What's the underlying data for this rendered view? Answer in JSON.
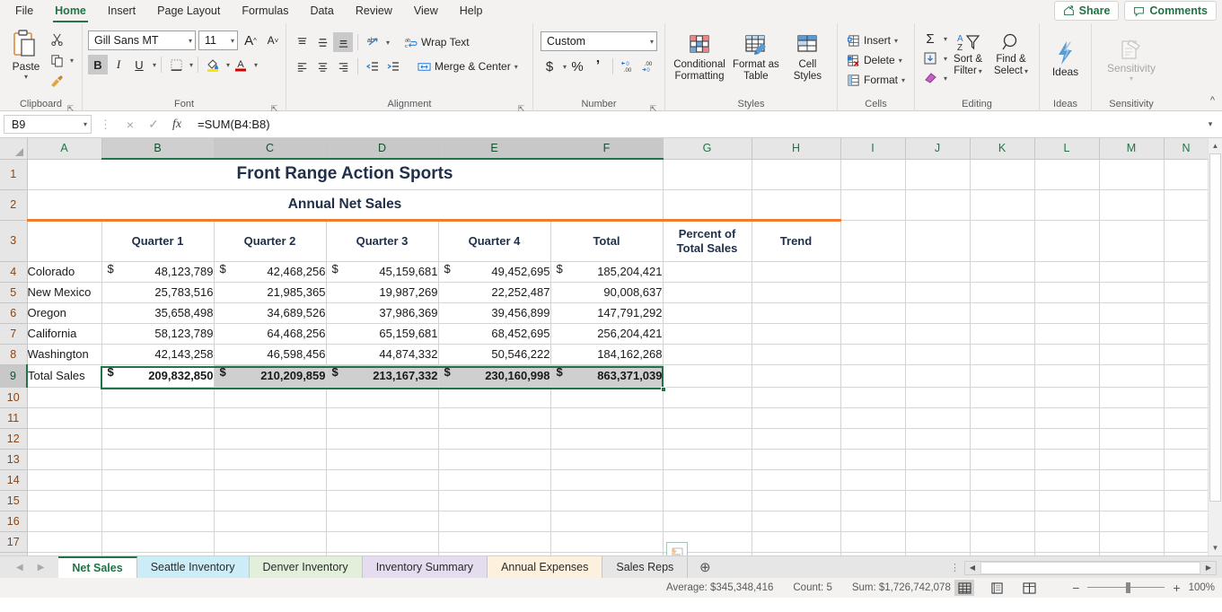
{
  "ribbon": {
    "tabs": [
      {
        "label": "File"
      },
      {
        "label": "Home"
      },
      {
        "label": "Insert"
      },
      {
        "label": "Page Layout"
      },
      {
        "label": "Formulas"
      },
      {
        "label": "Data"
      },
      {
        "label": "Review"
      },
      {
        "label": "View"
      },
      {
        "label": "Help"
      }
    ],
    "share_label": "Share",
    "comments_label": "Comments",
    "groups": {
      "clipboard": {
        "label": "Clipboard",
        "paste_label": "Paste",
        "cut_name": "cut-icon",
        "copy_name": "copy-icon",
        "format_painter_name": "format-painter-icon"
      },
      "font": {
        "label": "Font",
        "font_name": "Gill Sans MT",
        "font_size": "11",
        "grow_label": "A",
        "shrink_label": "A",
        "bold_label": "B",
        "italic_label": "I",
        "underline_label": "U"
      },
      "alignment": {
        "label": "Alignment",
        "wrap_text_label": "Wrap Text",
        "merge_center_label": "Merge & Center"
      },
      "number": {
        "label": "Number",
        "format_value": "Custom",
        "currency_label": "$",
        "percent_label": "%",
        "comma_label": " , ",
        "decrease_decimal_label": ".00",
        "increase_decimal_label": ".00"
      },
      "styles": {
        "label": "Styles",
        "conditional_formatting_label": "Conditional\nFormatting",
        "conditional_formatting_l1": "Conditional",
        "conditional_formatting_l2": "Formatting",
        "format_as_table_l1": "Format as",
        "format_as_table_l2": "Table",
        "cell_styles_l1": "Cell",
        "cell_styles_l2": "Styles"
      },
      "cells": {
        "label": "Cells",
        "insert_label": "Insert",
        "delete_label": "Delete",
        "format_label": "Format"
      },
      "editing": {
        "label": "Editing",
        "autosum_label": "Σ",
        "fill_label": "↓",
        "clear_label": "◇",
        "sort_filter_l1": "Sort &",
        "sort_filter_l2": "Filter",
        "find_select_l1": "Find &",
        "find_select_l2": "Select"
      },
      "ideas": {
        "label": "Ideas",
        "button_label": "Ideas"
      },
      "sensitivity": {
        "label": "Sensitivity",
        "button_label": "Sensitivity"
      }
    }
  },
  "formula_bar": {
    "name_box": "B9",
    "formula": "=SUM(B4:B8)",
    "cancel_icon": "×",
    "enter_icon": "✓",
    "function_icon": "fx"
  },
  "grid": {
    "column_headers": [
      "A",
      "B",
      "C",
      "D",
      "E",
      "F",
      "G",
      "H",
      "I",
      "J",
      "K",
      "L",
      "M",
      "N"
    ],
    "row_headers": [
      "1",
      "2",
      "3",
      "4",
      "5",
      "6",
      "7",
      "8",
      "9",
      "10",
      "11",
      "12",
      "13",
      "14",
      "15",
      "16",
      "17"
    ],
    "title": "Front Range Action Sports",
    "subtitle": "Annual Net Sales",
    "headers": {
      "blank": "",
      "q1": "Quarter 1",
      "q2": "Quarter 2",
      "q3": "Quarter 3",
      "q4": "Quarter 4",
      "total": "Total",
      "percent_l1": "Percent of",
      "percent_l2": "Total Sales",
      "trend": "Trend"
    },
    "currency_symbol": "$",
    "rows": [
      {
        "state": "Colorado",
        "q1": "48,123,789",
        "q2": "42,468,256",
        "q3": "45,159,681",
        "q4": "49,452,695",
        "total": "185,204,421"
      },
      {
        "state": "New Mexico",
        "q1": "25,783,516",
        "q2": "21,985,365",
        "q3": "19,987,269",
        "q4": "22,252,487",
        "total": "90,008,637"
      },
      {
        "state": "Oregon",
        "q1": "35,658,498",
        "q2": "34,689,526",
        "q3": "37,986,369",
        "q4": "39,456,899",
        "total": "147,791,292"
      },
      {
        "state": "California",
        "q1": "58,123,789",
        "q2": "64,468,256",
        "q3": "65,159,681",
        "q4": "68,452,695",
        "total": "256,204,421"
      },
      {
        "state": "Washington",
        "q1": "42,143,258",
        "q2": "46,598,456",
        "q3": "44,874,332",
        "q4": "50,546,222",
        "total": "184,162,268"
      }
    ],
    "total_row": {
      "label": "Total Sales",
      "q1": "209,832,850",
      "q2": "210,209,859",
      "q3": "213,167,332",
      "q4": "230,160,998",
      "total": "863,371,039"
    },
    "accent_color": "#ed7d31",
    "selection_color": "#217346",
    "quick_analysis_name": "quick-analysis-button"
  },
  "sheet_tabs": {
    "items": [
      {
        "label": "Net Sales",
        "color": "#ffffff",
        "active": true
      },
      {
        "label": "Seattle Inventory",
        "color": "#ccecf7",
        "active": false
      },
      {
        "label": "Denver Inventory",
        "color": "#e2efda",
        "active": false
      },
      {
        "label": "Inventory Summary",
        "color": "#e6dcf0",
        "active": false
      },
      {
        "label": "Annual Expenses",
        "color": "#fdf0dd",
        "active": false
      },
      {
        "label": "Sales Reps",
        "color": "#e6e6e6",
        "active": false
      }
    ],
    "add_sheet_label": "⊕"
  },
  "status_bar": {
    "average_label": "Average:  $345,348,416",
    "count_label": "Count: 5",
    "sum_label": "Sum:  $1,726,742,078",
    "zoom_label": "100%",
    "zoom_out_label": "−",
    "zoom_in_label": "+"
  }
}
